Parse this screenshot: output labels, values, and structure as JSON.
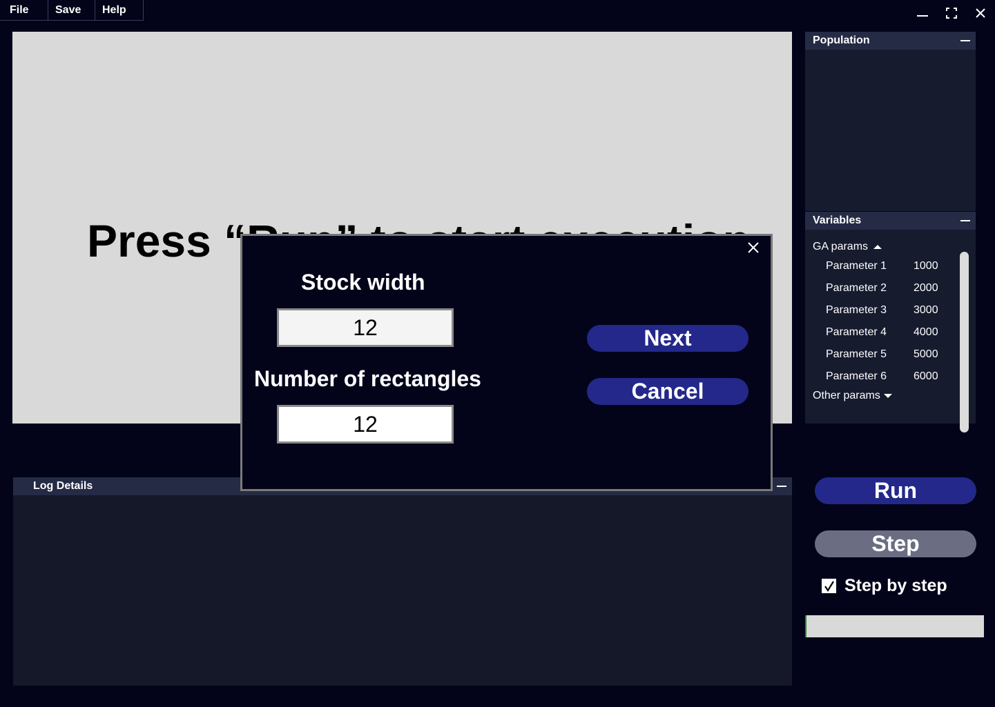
{
  "menu": {
    "file": "File",
    "save": "Save",
    "help": "Help"
  },
  "canvas": {
    "message": "Press “Run” to start execution"
  },
  "population": {
    "title": "Population"
  },
  "variables": {
    "title": "Variables",
    "ga_params_label": "GA params",
    "params": [
      {
        "name": "Parameter 1",
        "value": "1000"
      },
      {
        "name": "Parameter 2",
        "value": "2000"
      },
      {
        "name": "Parameter 3",
        "value": "3000"
      },
      {
        "name": "Parameter 4",
        "value": "4000"
      },
      {
        "name": "Parameter 5",
        "value": "5000"
      },
      {
        "name": "Parameter 6",
        "value": "6000"
      }
    ],
    "other_params_label": "Other params"
  },
  "log": {
    "title": "Log Details"
  },
  "controls": {
    "run_label": "Run",
    "step_label": "Step",
    "step_by_step_label": "Step by step",
    "step_by_step_checked": true
  },
  "dialog": {
    "stock_width_label": "Stock width",
    "stock_width_value": "12",
    "num_rects_label": "Number of rectangles",
    "num_rects_value": "12",
    "next_label": "Next",
    "cancel_label": "Cancel"
  },
  "colors": {
    "background": "#03041a",
    "panel": "#161b2e",
    "panel_header": "#252b45",
    "primary_button": "#23288a",
    "secondary_button": "#6b6d82",
    "canvas": "#d9d9d9"
  }
}
